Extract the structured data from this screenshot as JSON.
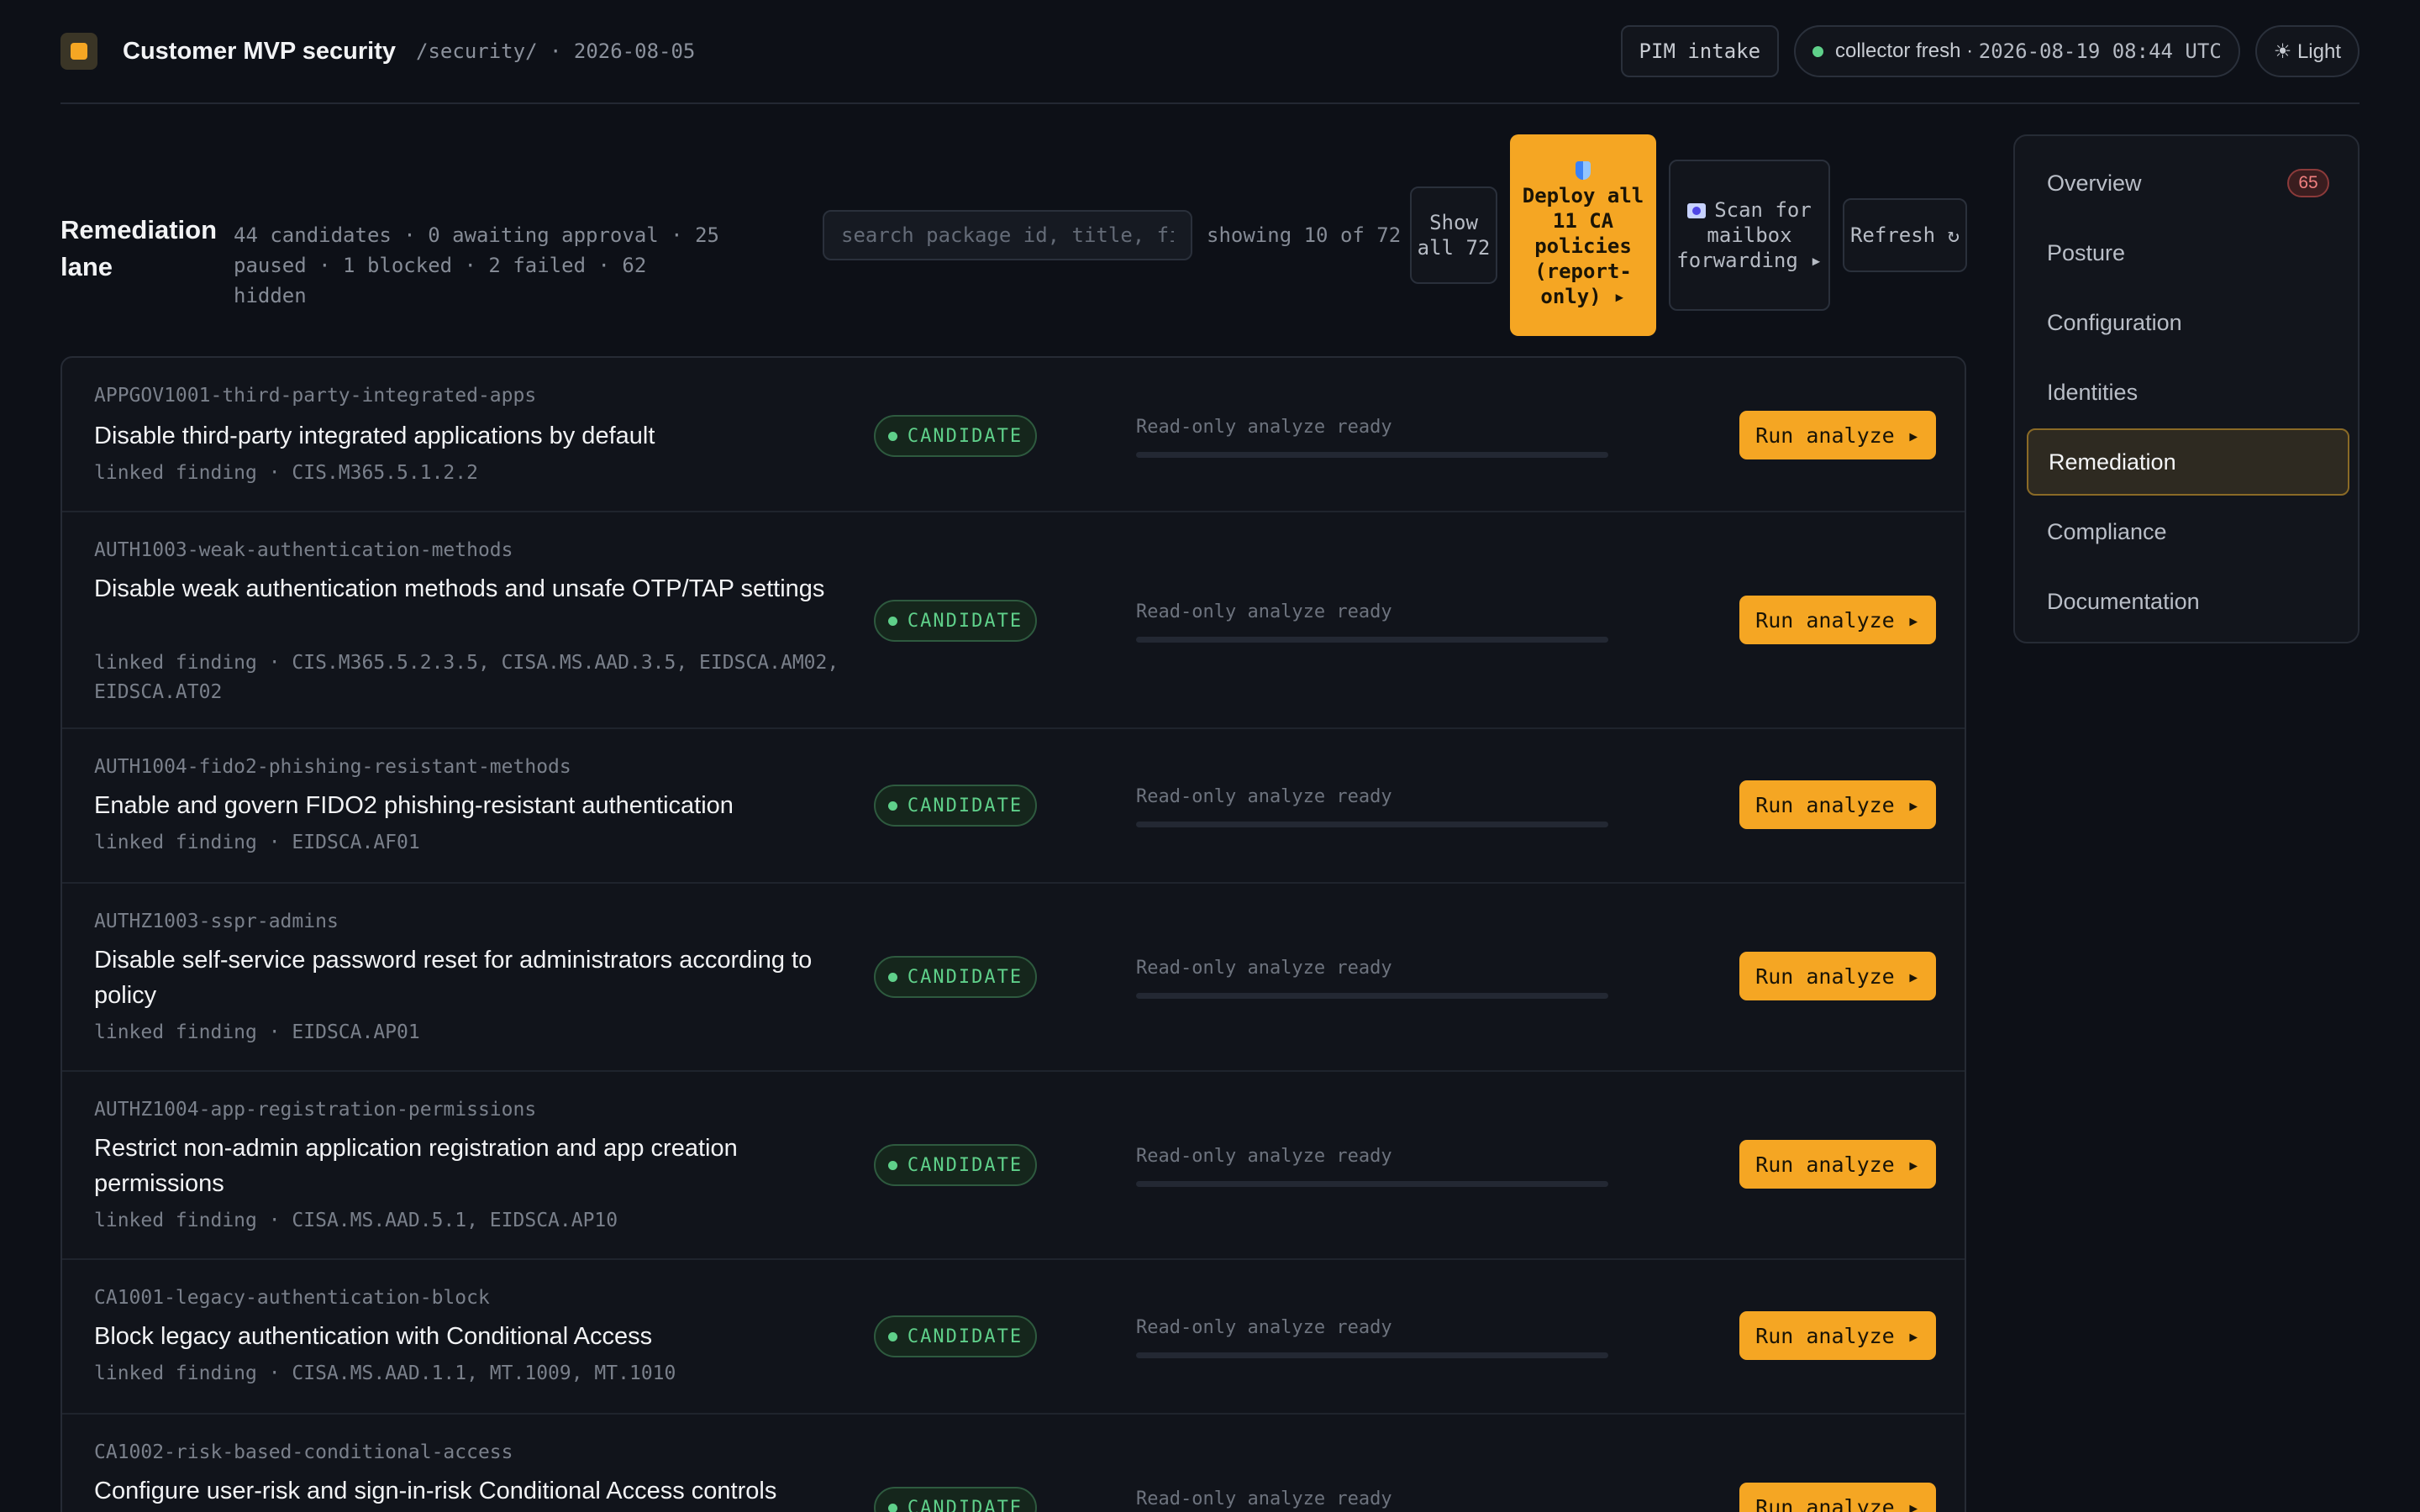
{
  "header": {
    "title": "Customer MVP security",
    "path": "/security/ · 2026-08-05",
    "pim_label": "PIM intake",
    "collector_label": "collector fresh ·",
    "collector_time": "2026-08-19 08:44 UTC",
    "theme_label": "☀ Light"
  },
  "toolbar": {
    "lane_title": "Remediation lane",
    "stats": "44 candidates · 0 awaiting approval · 25 paused · 1 blocked · 2 failed · 62 hidden",
    "search_placeholder": "search package id, title, finding…",
    "showing": "showing 10 of 72",
    "show_all": "Show all 72",
    "deploy": "Deploy all 11 CA policies (report-only) ▸",
    "scan": "Scan for mailbox forwarding ▸",
    "refresh": "Refresh ↻"
  },
  "row_labels": {
    "badge": "CANDIDATE",
    "ready": "Read-only analyze ready",
    "run": "Run analyze ▸",
    "analyze_progress": 0
  },
  "rows": [
    {
      "id": "APPGOV1001-third-party-integrated-apps",
      "title": "Disable third-party integrated applications by default",
      "link": "linked finding · CIS.M365.5.1.2.2"
    },
    {
      "id": "AUTH1003-weak-authentication-methods",
      "title": "Disable weak authentication methods and unsafe OTP/TAP settings",
      "link": "linked finding · CIS.M365.5.2.3.5, CISA.MS.AAD.3.5, EIDSCA.AM02, EIDSCA.AT02"
    },
    {
      "id": "AUTH1004-fido2-phishing-resistant-methods",
      "title": "Enable and govern FIDO2 phishing-resistant authentication",
      "link": "linked finding · EIDSCA.AF01"
    },
    {
      "id": "AUTHZ1003-sspr-admins",
      "title": "Disable self-service password reset for administrators according to policy",
      "link": "linked finding · EIDSCA.AP01"
    },
    {
      "id": "AUTHZ1004-app-registration-permissions",
      "title": "Restrict non-admin application registration and app creation permissions",
      "link": "linked finding · CISA.MS.AAD.5.1, EIDSCA.AP10"
    },
    {
      "id": "CA1001-legacy-authentication-block",
      "title": "Block legacy authentication with Conditional Access",
      "link": "linked finding · CISA.MS.AAD.1.1, MT.1009, MT.1010"
    },
    {
      "id": "CA1002-risk-based-conditional-access",
      "title": "Configure user-risk and sign-in-risk Conditional Access controls",
      "link": ""
    }
  ],
  "nav": {
    "items": [
      {
        "label": "Overview",
        "badge": "65"
      },
      {
        "label": "Posture"
      },
      {
        "label": "Configuration"
      },
      {
        "label": "Identities"
      },
      {
        "label": "Remediation",
        "active": true
      },
      {
        "label": "Compliance"
      },
      {
        "label": "Documentation"
      }
    ]
  },
  "colors": {
    "accent": "#f5a623",
    "background": "#0d1017",
    "candidate": "#5fd08a",
    "alert": "#f08080"
  },
  "icons": {
    "logo": "logo-square-icon",
    "collector": "status-dot-icon",
    "theme": "sun-icon",
    "deploy": "shield-icon",
    "scan": "globe-icon",
    "refresh": "refresh-icon"
  }
}
